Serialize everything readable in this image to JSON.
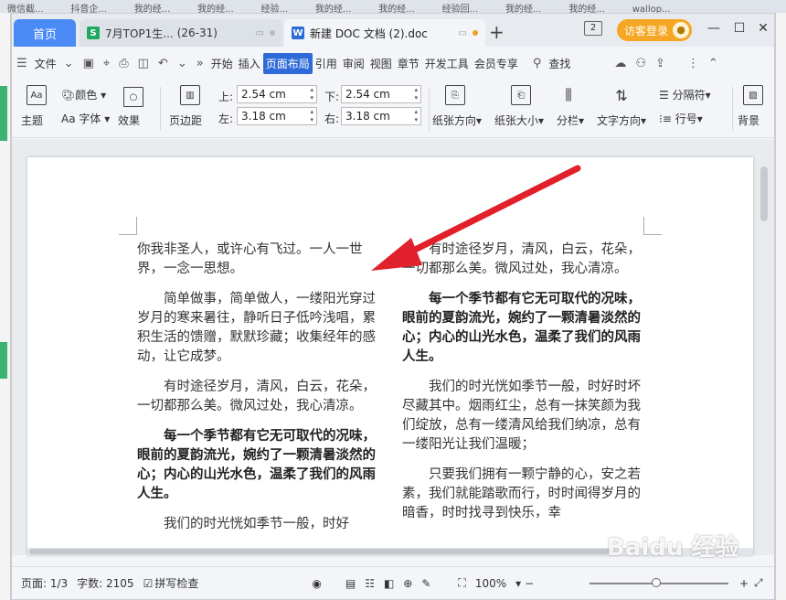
{
  "background_tabs": [
    "微信截...",
    "抖音企...",
    "我的经...",
    "我的经...",
    "经验...",
    "我的经...",
    "我的经...",
    "经验回...",
    "我的经...",
    "我的经...",
    "wallop..."
  ],
  "tabs": [
    {
      "label": "首页"
    },
    {
      "label": "7月TOP1生...",
      "extra": "(26-31)"
    },
    {
      "label": "新建 DOC 文档 (2).doc"
    }
  ],
  "titlebar": {
    "win_count": "2",
    "visitor_login": "访客登录"
  },
  "menu": {
    "file": "文件",
    "tabs": [
      "开始",
      "插入",
      "页面布局",
      "引用",
      "审阅",
      "视图",
      "章节",
      "开发工具",
      "会员专享"
    ],
    "active": "页面布局",
    "search": "查找"
  },
  "ribbon": {
    "theme": "主题",
    "color": "颜色",
    "font": "Aa 字体",
    "effect": "效果",
    "margin": "页边距",
    "top_label": "上:",
    "top_value": "2.54 cm",
    "bottom_label": "下:",
    "bottom_value": "2.54 cm",
    "left_label": "左:",
    "left_value": "3.18 cm",
    "right_label": "右:",
    "right_value": "3.18 cm",
    "orientation": "纸张方向",
    "size": "纸张大小",
    "columns": "分栏",
    "text_dir": "文字方向",
    "separator": "分隔符",
    "line_num": "行号",
    "background": "背景"
  },
  "document": {
    "left_column": [
      {
        "text": "你我非圣人，或许心有飞过。一人一世界，一念一思想。",
        "bold": false,
        "indent": false
      },
      {
        "text": "简单做事，简单做人，一缕阳光穿过岁月的寒来暑往，静听日子低吟浅唱，累积生活的馈赠，默默珍藏；收集经年的感动，让它成梦。",
        "bold": false,
        "indent": true
      },
      {
        "text": "有时途径岁月，清风，白云，花朵，一切都那么美。微风过处，我心清凉。",
        "bold": false,
        "indent": true
      },
      {
        "text": "每一个季节都有它无可取代的况味，眼前的夏韵流光，婉约了一颗清暑淡然的心；内心的山光水色，温柔了我们的风雨人生。",
        "bold": true,
        "indent": true
      },
      {
        "text": "我们的时光恍如季节一般，时好",
        "bold": false,
        "indent": true
      }
    ],
    "right_column": [
      {
        "text": "有时途径岁月，清风，白云，花朵，一切都那么美。微风过处，我心清凉。",
        "bold": false,
        "indent": true
      },
      {
        "text": "每一个季节都有它无可取代的况味，眼前的夏韵流光，婉约了一颗清暑淡然的心；内心的山光水色，温柔了我们的风雨人生。",
        "bold": true,
        "indent": true
      },
      {
        "text": "我们的时光恍如季节一般，时好时坏尽藏其中。烟雨红尘，总有一抹笑颜为我们绽放，总有一缕清风给我们纳凉，总有一缕阳光让我们温暖；",
        "bold": false,
        "indent": true
      },
      {
        "text": "只要我们拥有一颗宁静的心，安之若素，我们就能踏歌而行，时时闻得岁月的暗香，时时找寻到快乐，幸",
        "bold": false,
        "indent": true
      }
    ]
  },
  "status": {
    "page": "页面: 1/3",
    "words": "字数: 2105",
    "spell": "拼写检查",
    "zoom": "100%",
    "zoom_percent": 100
  },
  "watermark": "Baidu 经验",
  "colors": {
    "accent": "#2f6bd8",
    "home_tab": "#4a8af4",
    "visitor": "#f5a623",
    "arrow": "#e0202b"
  }
}
